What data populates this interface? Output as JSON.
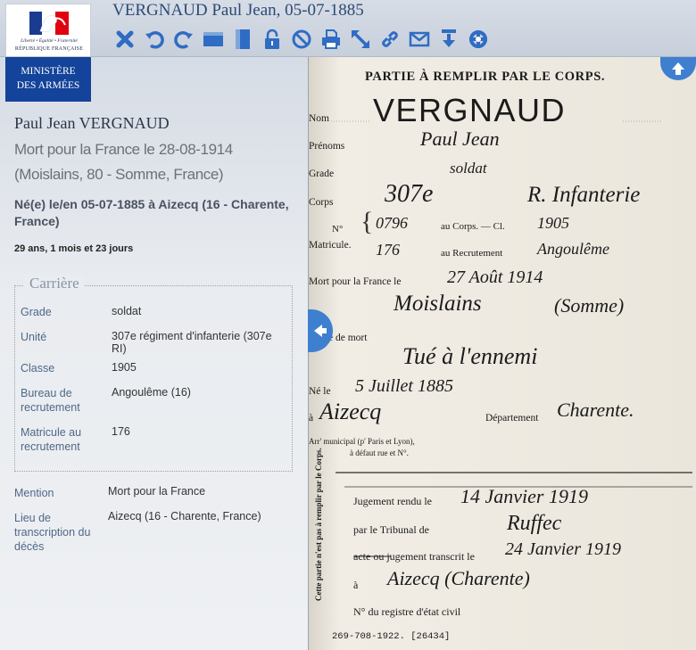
{
  "header": {
    "title": "VERGNAUD Paul Jean, 05-07-1885",
    "tools": [
      {
        "name": "close-icon",
        "label": "Fermer"
      },
      {
        "name": "rotate-left-icon",
        "label": "Rotation gauche"
      },
      {
        "name": "rotate-right-icon",
        "label": "Rotation droite"
      },
      {
        "name": "fit-width-icon",
        "label": "Ajuster largeur"
      },
      {
        "name": "fit-height-icon",
        "label": "Ajuster hauteur"
      },
      {
        "name": "lock-icon",
        "label": "Verrouiller"
      },
      {
        "name": "block-icon",
        "label": "Interdire"
      },
      {
        "name": "print-icon",
        "label": "Imprimer"
      },
      {
        "name": "fullscreen-icon",
        "label": "Plein écran"
      },
      {
        "name": "link-icon",
        "label": "Lien"
      },
      {
        "name": "mail-icon",
        "label": "Envoyer"
      },
      {
        "name": "download-icon",
        "label": "Télécharger"
      },
      {
        "name": "lifebuoy-icon",
        "label": "Aide"
      }
    ]
  },
  "logo": {
    "motto": "Liberté • Égalité • Fraternité",
    "republic": "RÉPUBLIQUE FRANÇAISE",
    "ministry_line1": "MINISTÈRE",
    "ministry_line2": "DES ARMÉES"
  },
  "person": {
    "name": "Paul Jean VERGNAUD",
    "death": "Mort pour la France le 28-08-1914 (Moislains, 80 - Somme, France)",
    "birth": "Né(e) le/en 05-07-1885 à Aizecq (16 - Charente, France)",
    "age": "29 ans, 1 mois et 23 jours"
  },
  "career": {
    "legend": "Carrière",
    "rows": [
      {
        "label": "Grade",
        "value": "soldat"
      },
      {
        "label": "Unité",
        "value": "307e régiment d'infanterie (307e RI)"
      },
      {
        "label": "Classe",
        "value": "1905"
      },
      {
        "label": "Bureau de recrutement",
        "value": "Angoulême (16)"
      },
      {
        "label": "Matricule au recrutement",
        "value": "176"
      }
    ]
  },
  "mention": {
    "rows": [
      {
        "label": "Mention",
        "value": "Mort pour la France"
      },
      {
        "label": "Lieu de transcription du décès",
        "value": "Aizecq (16 - Charente, France)"
      }
    ]
  },
  "document": {
    "header": "PARTIE À REMPLIR PAR LE CORPS.",
    "nom_label": "Nom",
    "nom_value": "VERGNAUD",
    "prenoms_label": "Prénoms",
    "prenoms_value": "Paul Jean",
    "grade_label": "Grade",
    "grade_value": "soldat",
    "corps_label": "Corps",
    "corps_value": "307e",
    "corps_value2": "R. Infanterie",
    "no_label": "N°",
    "matricule_label": "Matricule.",
    "no_corps_value": "0796",
    "au_corps_label": "au Corps. — Cl.",
    "classe_value": "1905",
    "no_recr_value": "176",
    "au_recr_label": "au Recrutement",
    "recr_value": "Angoulême",
    "mort_label": "Mort pour la France le",
    "mort_value": "27 Août 1914",
    "lieu_value": "Moislains",
    "lieu_value2": "(Somme)",
    "genre_label": "e de mort",
    "genre_value": "Tué à l'ennemi",
    "ne_label": "Né le",
    "ne_value": "5 Juillet 1885",
    "a_label": "à",
    "a_value": "Aizecq",
    "dept_label": "Département",
    "dept_value": "Charente.",
    "arr_label": "Arr' municipal (p' Paris et Lyon),",
    "arr_label2": "à défaut rue et N°.",
    "side_note": "Cette partie n'est pas à remplir par le Corps.",
    "jugement_label": "Jugement rendu le",
    "jugement_value": "14 Janvier 1919",
    "tribunal_label": "par le Tribunal de",
    "tribunal_value": "Ruffec",
    "acte_label": "acte ou jugement transcrit le",
    "transcrit_value": "24 Janvier 1919",
    "a2_label": "à",
    "a2_value": "Aizecq (Charente)",
    "registre_label": "N° du registre d'état civil",
    "footer": "269-708-1922.   [26434]"
  },
  "colors": {
    "accent_blue": "#3f7fd0",
    "ministry_blue": "#13439a",
    "title_blue": "#2d4a75"
  }
}
